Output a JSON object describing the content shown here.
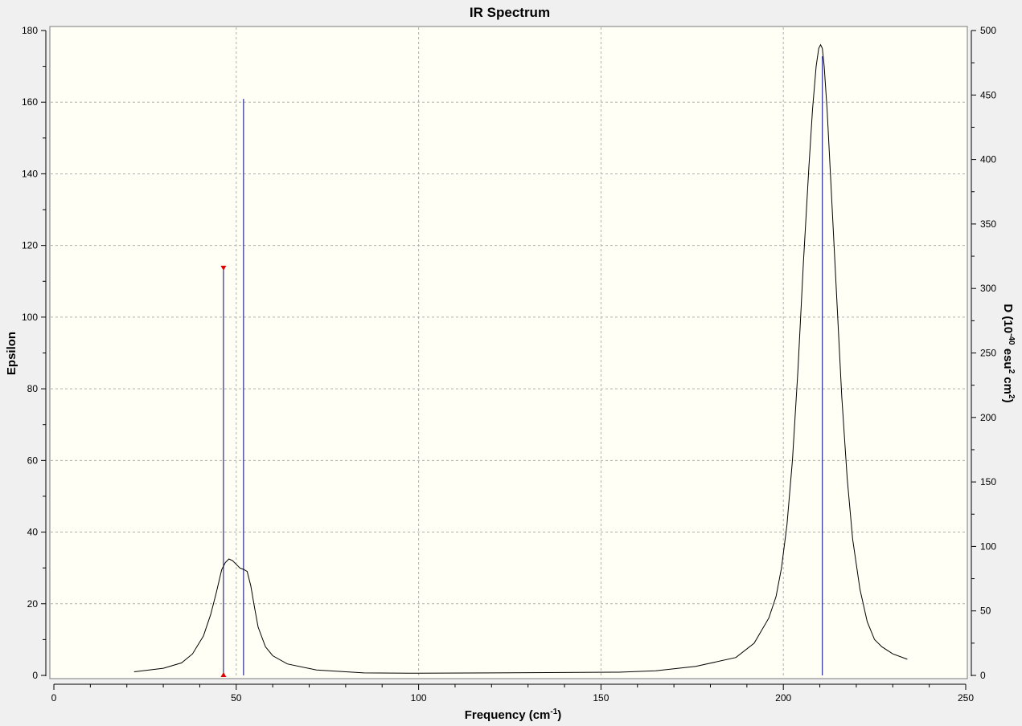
{
  "chart_data": {
    "type": "line",
    "title": "IR Spectrum",
    "xlabel": {
      "base": "Frequency (cm",
      "sup": "-1",
      "close": ")"
    },
    "ylabel_left": "Epsilon",
    "ylabel_right": {
      "p1": "D (10",
      "s1": "-40",
      "p2": " esu",
      "s2": "2",
      "p3": " cm",
      "s3": "2",
      "p4": ")"
    },
    "xlim": [
      0,
      250
    ],
    "ylim_left": [
      0,
      180
    ],
    "ylim_right": [
      0,
      500
    ],
    "x_ticks": [
      0,
      50,
      100,
      150,
      200,
      250
    ],
    "y_ticks_left": [
      0,
      20,
      40,
      60,
      80,
      100,
      120,
      140,
      160,
      180
    ],
    "y_ticks_right": [
      0,
      50,
      100,
      150,
      200,
      250,
      300,
      350,
      400,
      450,
      500
    ],
    "grid": true,
    "colors": {
      "plot_background": "#fffff5",
      "curve": "#000000",
      "sticks": "#000080",
      "marker": "#e00000",
      "grid": "#b0b0b0"
    },
    "spectrum": {
      "x": [
        22,
        30,
        35,
        38,
        41,
        43,
        44.5,
        46,
        47,
        48,
        49,
        50,
        51,
        52,
        53,
        54,
        55,
        56,
        58,
        60,
        64,
        72,
        85,
        100,
        120,
        140,
        155,
        165,
        176,
        187,
        192,
        196,
        198,
        199.5,
        201,
        202.5,
        204,
        205.5,
        207,
        208,
        209,
        209.7,
        210.2,
        210.7,
        211.2,
        212,
        213,
        214.5,
        216,
        217.5,
        219,
        221,
        223,
        225,
        227,
        230,
        234
      ],
      "y": [
        1,
        2,
        3.5,
        6,
        11,
        17,
        23,
        29.5,
        31.5,
        32.5,
        32,
        31,
        30,
        29.6,
        29,
        25,
        19,
        13.5,
        8,
        5.5,
        3.2,
        1.5,
        0.7,
        0.6,
        0.7,
        0.8,
        0.9,
        1.3,
        2.5,
        5,
        9,
        16,
        22,
        30,
        42,
        60,
        85,
        115,
        142,
        158,
        170,
        175,
        176,
        175,
        170,
        158,
        138,
        108,
        78,
        55,
        38,
        24,
        15,
        10,
        8,
        6,
        4.5
      ]
    },
    "sticks": [
      {
        "x": 46.5,
        "d": 317
      },
      {
        "x": 52.0,
        "d": 447
      },
      {
        "x": 210.7,
        "d": 480
      }
    ],
    "selected_stick": 0
  }
}
